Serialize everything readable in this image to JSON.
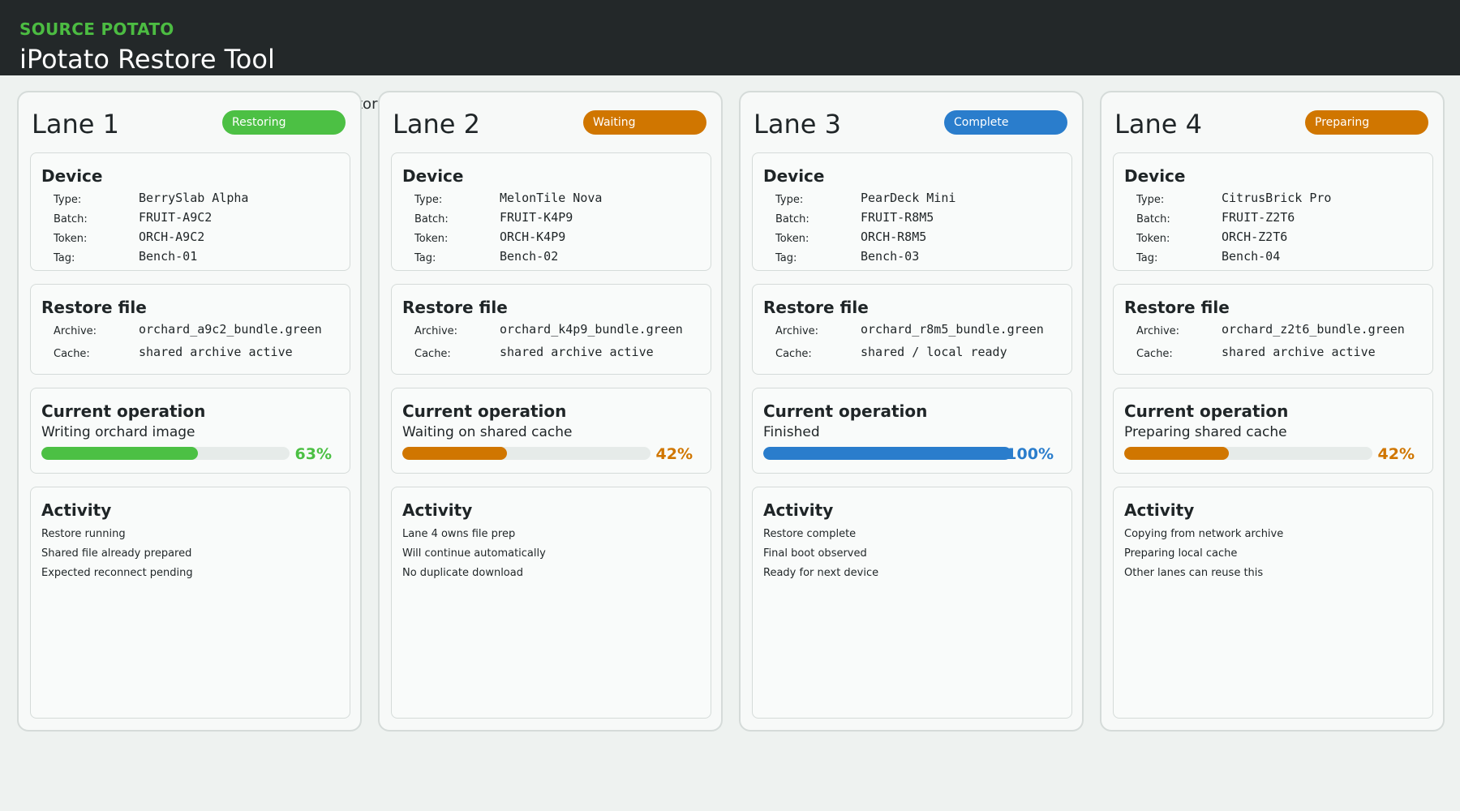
{
  "header": {
    "brand": "SOURCE POTATO",
    "title": "iPotato Restore Tool"
  },
  "stray_text": "tor",
  "labels": {
    "device": "Device",
    "type": "Type:",
    "batch": "Batch:",
    "token": "Token:",
    "tag": "Tag:",
    "restore_file": "Restore file",
    "archive": "Archive:",
    "cache": "Cache:",
    "current_operation": "Current operation",
    "activity": "Activity"
  },
  "colors": {
    "green": "#4cc044",
    "orange": "#d07600",
    "blue": "#2a7dcc"
  },
  "lanes": [
    {
      "title": "Lane 1",
      "status": "Restoring",
      "status_color": "#4cc044",
      "device": {
        "type": "BerrySlab Alpha",
        "batch": "FRUIT-A9C2",
        "token": "ORCH-A9C2",
        "tag": "Bench-01"
      },
      "restore": {
        "archive": "orchard_a9c2_bundle.green",
        "cache": "shared archive active"
      },
      "operation": {
        "text": "Writing orchard image",
        "progress": 63,
        "progress_label": "63%"
      },
      "activity": [
        "Restore running",
        "Shared file already prepared",
        "Expected reconnect pending"
      ]
    },
    {
      "title": "Lane 2",
      "status": "Waiting",
      "status_color": "#d07600",
      "device": {
        "type": "MelonTile Nova",
        "batch": "FRUIT-K4P9",
        "token": "ORCH-K4P9",
        "tag": "Bench-02"
      },
      "restore": {
        "archive": "orchard_k4p9_bundle.green",
        "cache": "shared archive active"
      },
      "operation": {
        "text": "Waiting on shared cache",
        "progress": 42,
        "progress_label": "42%"
      },
      "activity": [
        "Lane 4 owns file prep",
        "Will continue automatically",
        "No duplicate download"
      ]
    },
    {
      "title": "Lane 3",
      "status": "Complete",
      "status_color": "#2a7dcc",
      "device": {
        "type": "PearDeck Mini",
        "batch": "FRUIT-R8M5",
        "token": "ORCH-R8M5",
        "tag": "Bench-03"
      },
      "restore": {
        "archive": "orchard_r8m5_bundle.green",
        "cache": "shared / local ready"
      },
      "operation": {
        "text": "Finished",
        "progress": 100,
        "progress_label": "100%"
      },
      "activity": [
        "Restore complete",
        "Final boot observed",
        "Ready for next device"
      ]
    },
    {
      "title": "Lane 4",
      "status": "Preparing",
      "status_color": "#d07600",
      "device": {
        "type": "CitrusBrick Pro",
        "batch": "FRUIT-Z2T6",
        "token": "ORCH-Z2T6",
        "tag": "Bench-04"
      },
      "restore": {
        "archive": "orchard_z2t6_bundle.green",
        "cache": "shared archive active"
      },
      "operation": {
        "text": "Preparing shared cache",
        "progress": 42,
        "progress_label": "42%"
      },
      "activity": [
        "Copying from network archive",
        "Preparing local cache",
        "Other lanes can reuse this"
      ]
    }
  ]
}
